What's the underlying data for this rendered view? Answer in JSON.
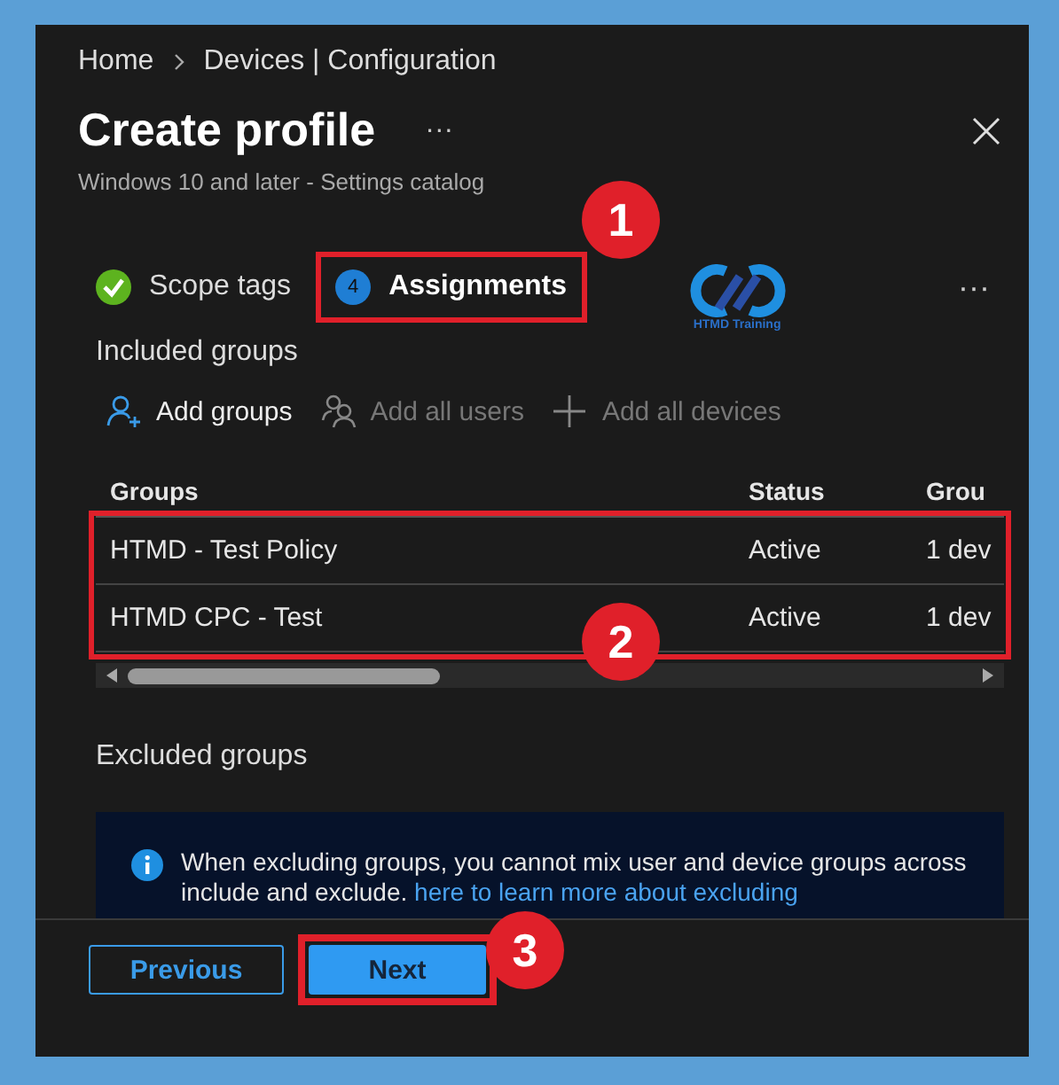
{
  "breadcrumb": [
    "Home",
    "Devices | Configuration"
  ],
  "title": "Create profile",
  "title_more": "···",
  "subtitle": "Windows 10 and later - Settings catalog",
  "steps": [
    {
      "kind": "done",
      "label": "Scope tags",
      "selected": false,
      "highlighted": false
    },
    {
      "kind": "current",
      "number": "4",
      "label": "Assignments",
      "selected": true,
      "highlighted": true
    }
  ],
  "logo": {
    "caption": "HTMD Training"
  },
  "steps_more": "···",
  "included": {
    "heading": "Included groups",
    "actions": [
      {
        "kind": "add-group",
        "label": "Add groups",
        "disabled": false
      },
      {
        "kind": "users",
        "label": "Add all users",
        "disabled": true
      },
      {
        "kind": "plus",
        "label": "Add all devices",
        "disabled": true
      }
    ],
    "table": {
      "columns": [
        "Groups",
        "Status",
        "Grou"
      ],
      "highlighted": true,
      "rows": [
        [
          "HTMD - Test Policy",
          "Active",
          "1 dev"
        ],
        [
          "HTMD CPC - Test",
          "Active",
          "1 dev"
        ]
      ]
    }
  },
  "excluded": {
    "heading": "Excluded groups",
    "message": "When excluding groups, you cannot mix user and device groups across include and exclude.",
    "link": "here to learn more about excluding"
  },
  "buttons": [
    {
      "kind": "secondary",
      "label": "Previous",
      "highlighted": false
    },
    {
      "kind": "primary",
      "label": "Next",
      "highlighted": true
    }
  ],
  "annotations": [
    "1",
    "2",
    "3"
  ]
}
